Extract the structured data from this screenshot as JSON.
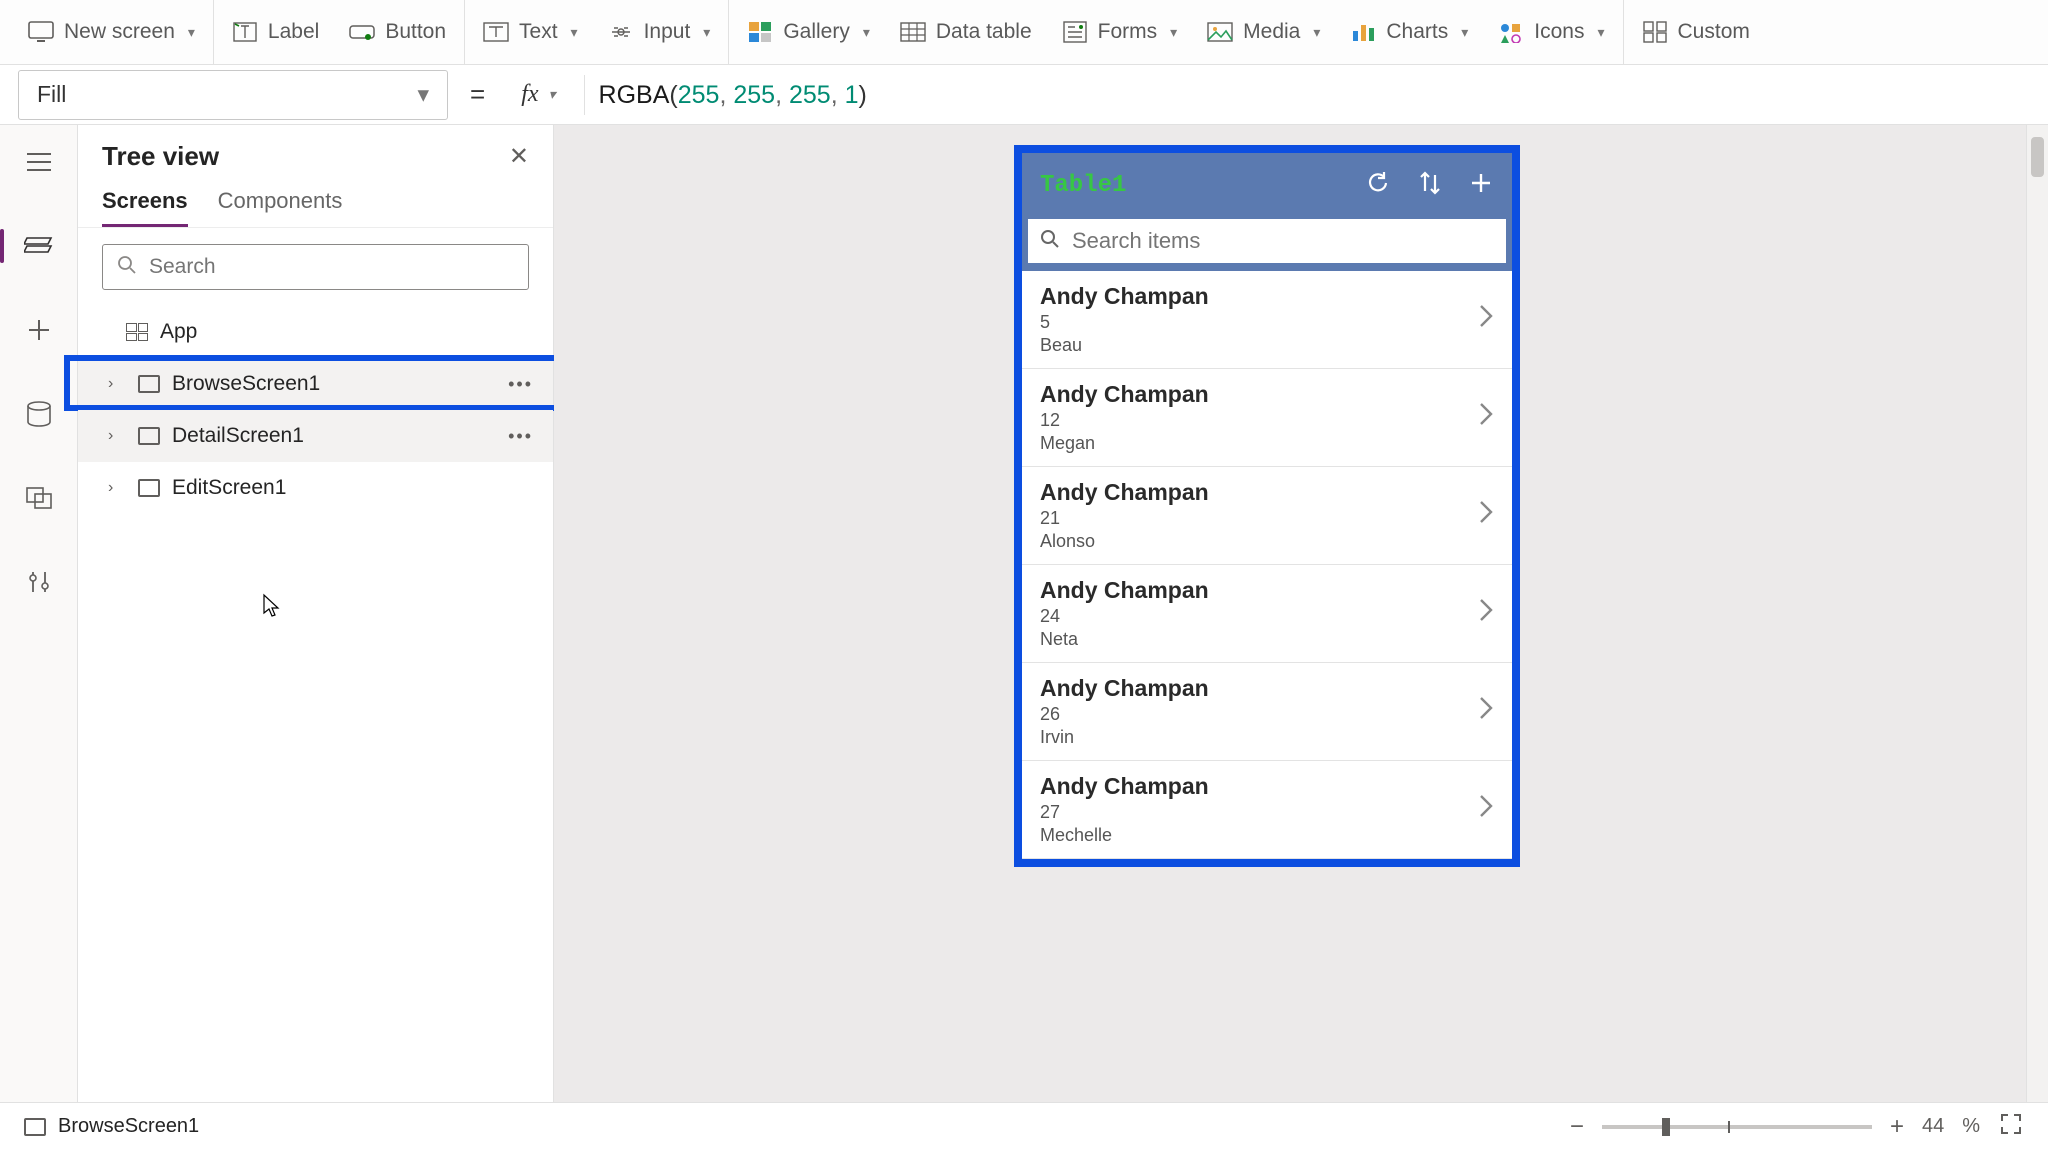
{
  "ribbon": {
    "new_screen": "New screen",
    "label": "Label",
    "button": "Button",
    "text": "Text",
    "input": "Input",
    "gallery": "Gallery",
    "data_table": "Data table",
    "forms": "Forms",
    "media": "Media",
    "charts": "Charts",
    "icons": "Icons",
    "custom": "Custom"
  },
  "formula": {
    "property": "Fill",
    "fx_label": "fx",
    "expr_func": "RGBA",
    "expr_args": [
      "255",
      "255",
      "255",
      "1"
    ]
  },
  "tree": {
    "title": "Tree view",
    "tabs": {
      "screens": "Screens",
      "components": "Components"
    },
    "search_placeholder": "Search",
    "items": {
      "app": "App",
      "browse": "BrowseScreen1",
      "detail": "DetailScreen1",
      "edit": "EditScreen1"
    }
  },
  "phone": {
    "title": "Table1",
    "search_placeholder": "Search items",
    "rows": [
      {
        "title": "Andy Champan",
        "line2": "5",
        "line3": "Beau"
      },
      {
        "title": "Andy Champan",
        "line2": "12",
        "line3": "Megan"
      },
      {
        "title": "Andy Champan",
        "line2": "21",
        "line3": "Alonso"
      },
      {
        "title": "Andy Champan",
        "line2": "24",
        "line3": "Neta"
      },
      {
        "title": "Andy Champan",
        "line2": "26",
        "line3": "Irvin"
      },
      {
        "title": "Andy Champan",
        "line2": "27",
        "line3": "Mechelle"
      }
    ]
  },
  "status": {
    "selected": "BrowseScreen1",
    "zoom_value": "44",
    "zoom_unit": "%"
  }
}
